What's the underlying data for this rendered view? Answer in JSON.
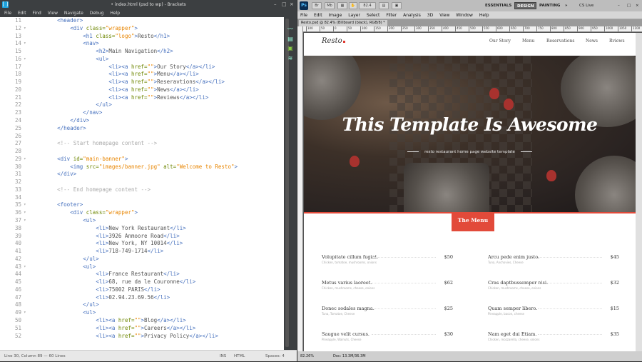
{
  "brackets": {
    "title": "• index.html (psd to wp) - Brackets",
    "menu": [
      "File",
      "Edit",
      "Find",
      "View",
      "Navigate",
      "Debug",
      "Help"
    ],
    "status": {
      "position": "Line 30, Column 89 — 60 Lines",
      "ins": "INS",
      "mode": "HTML",
      "spaces": "Spaces: 4"
    },
    "code": [
      {
        "n": "11",
        "parts": [
          [
            "i",
            "        "
          ],
          [
            "t",
            "<header>"
          ]
        ]
      },
      {
        "n": "12",
        "parts": [
          [
            "i",
            "            "
          ],
          [
            "t",
            "<div "
          ],
          [
            "a",
            "class="
          ],
          [
            "s",
            "\"wrapper\""
          ],
          [
            "t",
            ">"
          ]
        ]
      },
      {
        "n": "13",
        "parts": [
          [
            "i",
            "                "
          ],
          [
            "t",
            "<h1 "
          ],
          [
            "a",
            "class="
          ],
          [
            "s",
            "\"logo\""
          ],
          [
            "t",
            ">"
          ],
          [
            "p",
            "Resto"
          ],
          [
            "t",
            "</h1>"
          ]
        ]
      },
      {
        "n": "14",
        "parts": [
          [
            "i",
            "                "
          ],
          [
            "t",
            "<nav>"
          ]
        ]
      },
      {
        "n": "15",
        "parts": [
          [
            "i",
            "                    "
          ],
          [
            "t",
            "<h2>"
          ],
          [
            "p",
            "Main Navigation"
          ],
          [
            "t",
            "</h2>"
          ]
        ]
      },
      {
        "n": "16",
        "parts": [
          [
            "i",
            "                    "
          ],
          [
            "t",
            "<ul>"
          ]
        ]
      },
      {
        "n": "17",
        "parts": [
          [
            "i",
            "                        "
          ],
          [
            "t",
            "<li><a "
          ],
          [
            "a",
            "href="
          ],
          [
            "s",
            "\"\""
          ],
          [
            "t",
            ">"
          ],
          [
            "p",
            "Our Story"
          ],
          [
            "t",
            "</a></li>"
          ]
        ]
      },
      {
        "n": "18",
        "parts": [
          [
            "i",
            "                        "
          ],
          [
            "t",
            "<li><a "
          ],
          [
            "a",
            "href="
          ],
          [
            "s",
            "\"\""
          ],
          [
            "t",
            ">"
          ],
          [
            "p",
            "Menu"
          ],
          [
            "t",
            "</a></li>"
          ]
        ]
      },
      {
        "n": "19",
        "parts": [
          [
            "i",
            "                        "
          ],
          [
            "t",
            "<li><a "
          ],
          [
            "a",
            "href="
          ],
          [
            "s",
            "\"\""
          ],
          [
            "t",
            ">"
          ],
          [
            "p",
            "Reseravtions"
          ],
          [
            "t",
            "</a></li>"
          ]
        ]
      },
      {
        "n": "20",
        "parts": [
          [
            "i",
            "                        "
          ],
          [
            "t",
            "<li><a "
          ],
          [
            "a",
            "href="
          ],
          [
            "s",
            "\"\""
          ],
          [
            "t",
            ">"
          ],
          [
            "p",
            "News"
          ],
          [
            "t",
            "</a></li>"
          ]
        ]
      },
      {
        "n": "21",
        "parts": [
          [
            "i",
            "                        "
          ],
          [
            "t",
            "<li><a "
          ],
          [
            "a",
            "href="
          ],
          [
            "s",
            "\"\""
          ],
          [
            "t",
            ">"
          ],
          [
            "p",
            "Reviews"
          ],
          [
            "t",
            "</a></li>"
          ]
        ]
      },
      {
        "n": "22",
        "parts": [
          [
            "i",
            "                    "
          ],
          [
            "t",
            "</ul>"
          ]
        ]
      },
      {
        "n": "23",
        "parts": [
          [
            "i",
            "                "
          ],
          [
            "t",
            "</nav>"
          ]
        ]
      },
      {
        "n": "24",
        "parts": [
          [
            "i",
            "            "
          ],
          [
            "t",
            "</div>"
          ]
        ]
      },
      {
        "n": "25",
        "parts": [
          [
            "i",
            "        "
          ],
          [
            "t",
            "</header>"
          ]
        ]
      },
      {
        "n": "26",
        "parts": []
      },
      {
        "n": "27",
        "parts": [
          [
            "i",
            "        "
          ],
          [
            "c",
            "<!-- Start homepage content -->"
          ]
        ]
      },
      {
        "n": "28",
        "parts": []
      },
      {
        "n": "29",
        "parts": [
          [
            "i",
            "        "
          ],
          [
            "t",
            "<div "
          ],
          [
            "a",
            "id="
          ],
          [
            "s",
            "\"main-banner\""
          ],
          [
            "t",
            ">"
          ]
        ]
      },
      {
        "n": "30",
        "parts": [
          [
            "i",
            "            "
          ],
          [
            "t",
            "<img "
          ],
          [
            "a",
            "src="
          ],
          [
            "s",
            "\"images/banner.jpg\""
          ],
          [
            "t",
            " "
          ],
          [
            "a",
            "alt="
          ],
          [
            "s",
            "\"Welcome to Resto\""
          ],
          [
            "t",
            ">"
          ]
        ]
      },
      {
        "n": "31",
        "parts": [
          [
            "i",
            "        "
          ],
          [
            "t",
            "</div>"
          ]
        ]
      },
      {
        "n": "32",
        "parts": []
      },
      {
        "n": "33",
        "parts": [
          [
            "i",
            "        "
          ],
          [
            "c",
            "<!-- End homepage content -->"
          ]
        ]
      },
      {
        "n": "34",
        "parts": []
      },
      {
        "n": "35",
        "parts": [
          [
            "i",
            "        "
          ],
          [
            "t",
            "<footer>"
          ]
        ]
      },
      {
        "n": "36",
        "parts": [
          [
            "i",
            "            "
          ],
          [
            "t",
            "<div "
          ],
          [
            "a",
            "class="
          ],
          [
            "s",
            "\"wrapper\""
          ],
          [
            "t",
            ">"
          ]
        ]
      },
      {
        "n": "37",
        "parts": [
          [
            "i",
            "                "
          ],
          [
            "t",
            "<ul>"
          ]
        ]
      },
      {
        "n": "38",
        "parts": [
          [
            "i",
            "                    "
          ],
          [
            "t",
            "<li>"
          ],
          [
            "p",
            "New York Restaurant"
          ],
          [
            "t",
            "</li>"
          ]
        ]
      },
      {
        "n": "39",
        "parts": [
          [
            "i",
            "                    "
          ],
          [
            "t",
            "<li>"
          ],
          [
            "p",
            "3926 Anmoore Road"
          ],
          [
            "t",
            "</li>"
          ]
        ]
      },
      {
        "n": "40",
        "parts": [
          [
            "i",
            "                    "
          ],
          [
            "t",
            "<li>"
          ],
          [
            "p",
            "New York, NY 10014"
          ],
          [
            "t",
            "</li>"
          ]
        ]
      },
      {
        "n": "41",
        "parts": [
          [
            "i",
            "                    "
          ],
          [
            "t",
            "<li>"
          ],
          [
            "p",
            "718-749-1714"
          ],
          [
            "t",
            "</li>"
          ]
        ]
      },
      {
        "n": "42",
        "parts": [
          [
            "i",
            "                "
          ],
          [
            "t",
            "</ul>"
          ]
        ]
      },
      {
        "n": "43",
        "parts": [
          [
            "i",
            "                "
          ],
          [
            "t",
            "<ul>"
          ]
        ]
      },
      {
        "n": "44",
        "parts": [
          [
            "i",
            "                    "
          ],
          [
            "t",
            "<li>"
          ],
          [
            "p",
            "France Restaurant"
          ],
          [
            "t",
            "</li>"
          ]
        ]
      },
      {
        "n": "45",
        "parts": [
          [
            "i",
            "                    "
          ],
          [
            "t",
            "<li>"
          ],
          [
            "p",
            "68, rue da le Couronne"
          ],
          [
            "t",
            "</li>"
          ]
        ]
      },
      {
        "n": "46",
        "parts": [
          [
            "i",
            "                    "
          ],
          [
            "t",
            "<li>"
          ],
          [
            "p",
            "75002 PARIS"
          ],
          [
            "t",
            "</li>"
          ]
        ]
      },
      {
        "n": "47",
        "parts": [
          [
            "i",
            "                    "
          ],
          [
            "t",
            "<li>"
          ],
          [
            "p",
            "02.94.23.69.56"
          ],
          [
            "t",
            "</li>"
          ]
        ]
      },
      {
        "n": "48",
        "parts": [
          [
            "i",
            "                "
          ],
          [
            "t",
            "</ul>"
          ]
        ]
      },
      {
        "n": "49",
        "parts": [
          [
            "i",
            "                "
          ],
          [
            "t",
            "<ul>"
          ]
        ]
      },
      {
        "n": "50",
        "parts": [
          [
            "i",
            "                    "
          ],
          [
            "t",
            "<li><a "
          ],
          [
            "a",
            "href="
          ],
          [
            "s",
            "\"\""
          ],
          [
            "t",
            ">"
          ],
          [
            "p",
            "Blog"
          ],
          [
            "t",
            "</a></li>"
          ]
        ]
      },
      {
        "n": "51",
        "parts": [
          [
            "i",
            "                    "
          ],
          [
            "t",
            "<li><a "
          ],
          [
            "a",
            "href="
          ],
          [
            "s",
            "\"\""
          ],
          [
            "t",
            ">"
          ],
          [
            "p",
            "Careers"
          ],
          [
            "t",
            "</a></li>"
          ]
        ]
      },
      {
        "n": "52",
        "parts": [
          [
            "i",
            "                    "
          ],
          [
            "t",
            "<li><a "
          ],
          [
            "a",
            "href="
          ],
          [
            "s",
            "\"\""
          ],
          [
            "t",
            ">"
          ],
          [
            "p",
            "Privacy Policy"
          ],
          [
            "t",
            "</a></li>"
          ]
        ]
      }
    ]
  },
  "photoshop": {
    "logo": "Ps",
    "zoom": "82.4",
    "workspaces": {
      "essentials": "ESSENTIALS",
      "design": "DESIGN",
      "painting": "PAINTING",
      "more": "»",
      "cslive": "CS Live"
    },
    "menu": [
      "File",
      "Edit",
      "Image",
      "Layer",
      "Select",
      "Filter",
      "Analysis",
      "3D",
      "View",
      "Window",
      "Help"
    ],
    "doc_tab": "Resto.psd @ 82.4% (Billboard (black), RGB/8) *",
    "ruler": [
      "100",
      "50",
      "0",
      "50",
      "100",
      "150",
      "200",
      "250",
      "300",
      "350",
      "400",
      "450",
      "500",
      "550",
      "600",
      "650",
      "700",
      "750",
      "800",
      "850",
      "900",
      "950",
      "1000",
      "1050",
      "1100",
      "1150"
    ],
    "status": {
      "zoom": "82.26%",
      "doc": "Doc: 13.3M/36.3M"
    }
  },
  "site": {
    "logo": "Resto",
    "nav": [
      "Our Story",
      "Menu",
      "Reservations",
      "News",
      "Rviews"
    ],
    "banner_title": "This Template Is Awesome",
    "banner_sub": "resto restaurant home page website template",
    "menu_badge": "The Menu",
    "items_left": [
      {
        "name": "Volupitate cillum fugiat.",
        "desc": "Chicken, tomatoe, mushrooms, onions",
        "price": "$50"
      },
      {
        "name": "Metus varius laoreet.",
        "desc": "Chicken, mushrooms, cheese, onions",
        "price": "$62"
      },
      {
        "name": "Donec sodales magna.",
        "desc": "Tuna, Tomatoe, Cheese",
        "price": "$25"
      },
      {
        "name": "Saugue velit cursus.",
        "desc": "Pineapple, Walnuts, Cheese",
        "price": "$30"
      }
    ],
    "items_right": [
      {
        "name": "Arcu pede enim justo.",
        "desc": "Tuna, Anchovies, Cheese",
        "price": "$45"
      },
      {
        "name": "Cras daptbussemper nisi.",
        "desc": "Chicken, mushrooms, cheese, onions",
        "price": "$32"
      },
      {
        "name": "Quam semper libero.",
        "desc": "Pineapple, bacon, cheese",
        "price": "$15"
      },
      {
        "name": "Nam eget dui Etiam.",
        "desc": "Chicken, mozzarella, cheese, onions",
        "price": "$35"
      }
    ]
  }
}
